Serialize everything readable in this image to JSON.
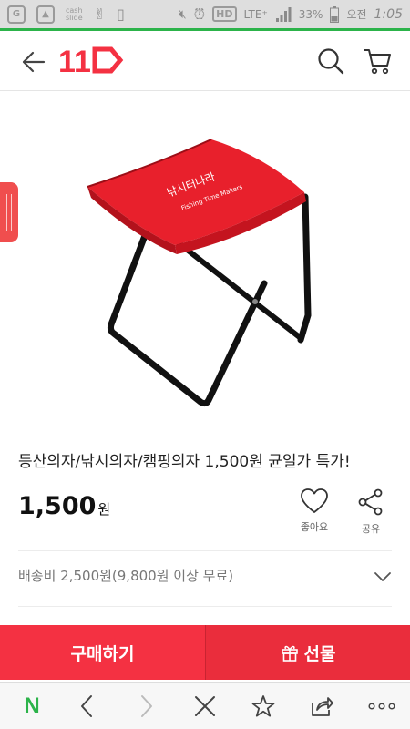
{
  "statusbar": {
    "cash_line1": "cash",
    "cash_line2": "slide",
    "hd_label": "HD",
    "lte_label": "LTE⁺",
    "battery": "33%",
    "ampm": "오전",
    "time": "1:05"
  },
  "header": {
    "logo_text": "11"
  },
  "product": {
    "title": "등산의자/낚시의자/캠핑의자 1,500원 균일가 특가!",
    "price": "1,500",
    "price_unit": "원",
    "like_label": "좋아요",
    "share_label": "공유",
    "shipping": "배송비 2,500원(9,800원 이상 무료)"
  },
  "actions": {
    "buy_label": "구매하기",
    "gift_label": "선물"
  },
  "browser": {
    "home_label": "N"
  },
  "colors": {
    "brand_red": "#f43142",
    "naver_green": "#2cb34a"
  }
}
